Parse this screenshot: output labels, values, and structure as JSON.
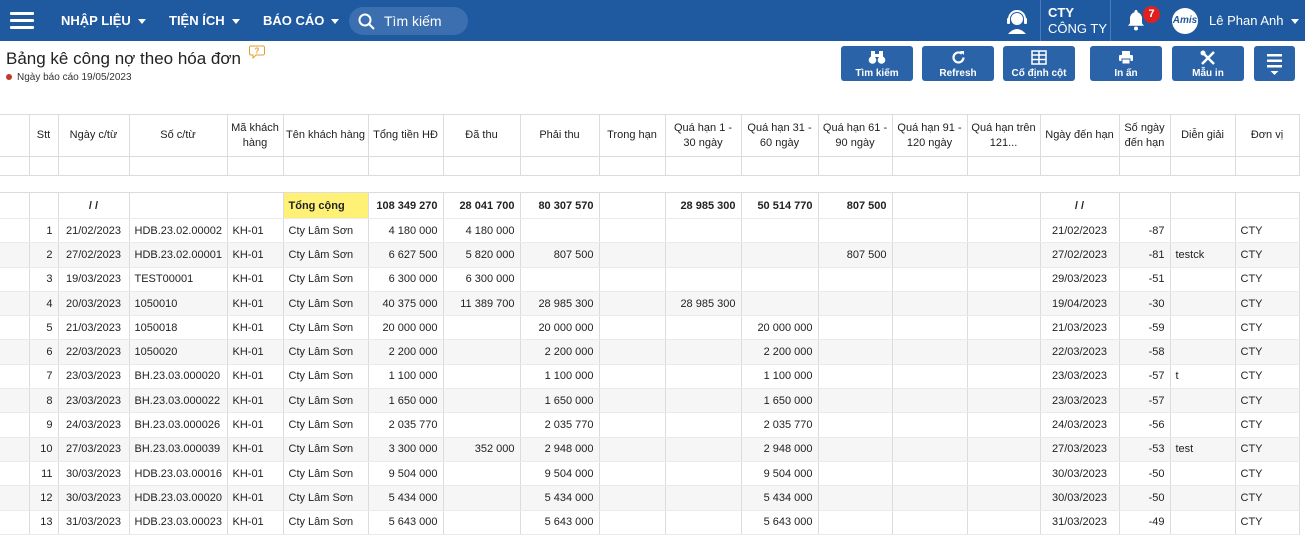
{
  "topbar": {
    "menu": [
      "NHẬP LIỆU",
      "TIỆN ÍCH",
      "BÁO CÁO"
    ],
    "search_placeholder": "Tìm kiếm",
    "company_code": "CTY",
    "company_name": "CÔNG TY",
    "notification_count": "7",
    "avatar_text": "Amis",
    "user_name": "Lê Phan Anh"
  },
  "page": {
    "title": "Bảng kê công nợ theo hóa đơn",
    "report_date": "Ngày báo cáo 19/05/2023"
  },
  "toolbar": {
    "search": "Tìm kiếm",
    "refresh": "Refresh",
    "freeze": "Cố định cột",
    "print": "In ấn",
    "template": "Mẫu in"
  },
  "table": {
    "headers": [
      "Stt",
      "Ngày c/từ",
      "Số c/từ",
      "Mã khách hàng",
      "Tên khách hàng",
      "Tổng tiền HĐ",
      "Đã thu",
      "Phải thu",
      "Trong hạn",
      "Quá hạn 1 - 30 ngày",
      "Quá hạn 31 - 60 ngày",
      "Quá hạn 61 - 90 ngày",
      "Quá hạn 91 - 120 ngày",
      "Quá hạn trên 121...",
      "Ngày đến hạn",
      "Số ngày đến hạn",
      "Diễn giải",
      "Đơn vị"
    ],
    "total": [
      "",
      "/ /",
      "",
      "",
      "Tổng cộng",
      "108 349 270",
      "28 041 700",
      "80 307 570",
      "",
      "28 985 300",
      "50 514 770",
      "807 500",
      "",
      "",
      "/ /",
      "",
      "",
      ""
    ],
    "rows": [
      [
        "1",
        "21/02/2023",
        "HDB.23.02.00002",
        "KH-01",
        "Cty Lâm Sơn",
        "4 180 000",
        "4 180 000",
        "",
        "",
        "",
        "",
        "",
        "",
        "",
        "21/02/2023",
        "-87",
        "",
        "CTY"
      ],
      [
        "2",
        "27/02/2023",
        "HDB.23.02.00001",
        "KH-01",
        "Cty Lâm Sơn",
        "6 627 500",
        "5 820 000",
        "807 500",
        "",
        "",
        "",
        "807 500",
        "",
        "",
        "27/02/2023",
        "-81",
        "testck",
        "CTY"
      ],
      [
        "3",
        "19/03/2023",
        "TEST00001",
        "KH-01",
        "Cty Lâm Sơn",
        "6 300 000",
        "6 300 000",
        "",
        "",
        "",
        "",
        "",
        "",
        "",
        "29/03/2023",
        "-51",
        "",
        "CTY"
      ],
      [
        "4",
        "20/03/2023",
        "1050010",
        "KH-01",
        "Cty Lâm Sơn",
        "40 375 000",
        "11 389 700",
        "28 985 300",
        "",
        "28 985 300",
        "",
        "",
        "",
        "",
        "19/04/2023",
        "-30",
        "",
        "CTY"
      ],
      [
        "5",
        "21/03/2023",
        "1050018",
        "KH-01",
        "Cty Lâm Sơn",
        "20 000 000",
        "",
        "20 000 000",
        "",
        "",
        "20 000 000",
        "",
        "",
        "",
        "21/03/2023",
        "-59",
        "",
        "CTY"
      ],
      [
        "6",
        "22/03/2023",
        "1050020",
        "KH-01",
        "Cty Lâm Sơn",
        "2 200 000",
        "",
        "2 200 000",
        "",
        "",
        "2 200 000",
        "",
        "",
        "",
        "22/03/2023",
        "-58",
        "",
        "CTY"
      ],
      [
        "7",
        "23/03/2023",
        "BH.23.03.000020",
        "KH-01",
        "Cty Lâm Sơn",
        "1 100 000",
        "",
        "1 100 000",
        "",
        "",
        "1 100 000",
        "",
        "",
        "",
        "23/03/2023",
        "-57",
        "t",
        "CTY"
      ],
      [
        "8",
        "23/03/2023",
        "BH.23.03.000022",
        "KH-01",
        "Cty Lâm Sơn",
        "1 650 000",
        "",
        "1 650 000",
        "",
        "",
        "1 650 000",
        "",
        "",
        "",
        "23/03/2023",
        "-57",
        "",
        "CTY"
      ],
      [
        "9",
        "24/03/2023",
        "BH.23.03.000026",
        "KH-01",
        "Cty Lâm Sơn",
        "2 035 770",
        "",
        "2 035 770",
        "",
        "",
        "2 035 770",
        "",
        "",
        "",
        "24/03/2023",
        "-56",
        "",
        "CTY"
      ],
      [
        "10",
        "27/03/2023",
        "BH.23.03.000039",
        "KH-01",
        "Cty Lâm Sơn",
        "3 300 000",
        "352 000",
        "2 948 000",
        "",
        "",
        "2 948 000",
        "",
        "",
        "",
        "27/03/2023",
        "-53",
        "test",
        "CTY"
      ],
      [
        "11",
        "30/03/2023",
        "HDB.23.03.00016",
        "KH-01",
        "Cty Lâm Sơn",
        "9 504 000",
        "",
        "9 504 000",
        "",
        "",
        "9 504 000",
        "",
        "",
        "",
        "30/03/2023",
        "-50",
        "",
        "CTY"
      ],
      [
        "12",
        "30/03/2023",
        "HDB.23.03.00020",
        "KH-01",
        "Cty Lâm Sơn",
        "5 434 000",
        "",
        "5 434 000",
        "",
        "",
        "5 434 000",
        "",
        "",
        "",
        "30/03/2023",
        "-50",
        "",
        "CTY"
      ],
      [
        "13",
        "31/03/2023",
        "HDB.23.03.00023",
        "KH-01",
        "Cty Lâm Sơn",
        "5 643 000",
        "",
        "5 643 000",
        "",
        "",
        "5 643 000",
        "",
        "",
        "",
        "31/03/2023",
        "-49",
        "",
        "CTY"
      ]
    ]
  },
  "colors": {
    "topbar": "#1f5aa0",
    "button": "#2a63a8",
    "highlight": "#fff176",
    "badge": "#e02020"
  }
}
